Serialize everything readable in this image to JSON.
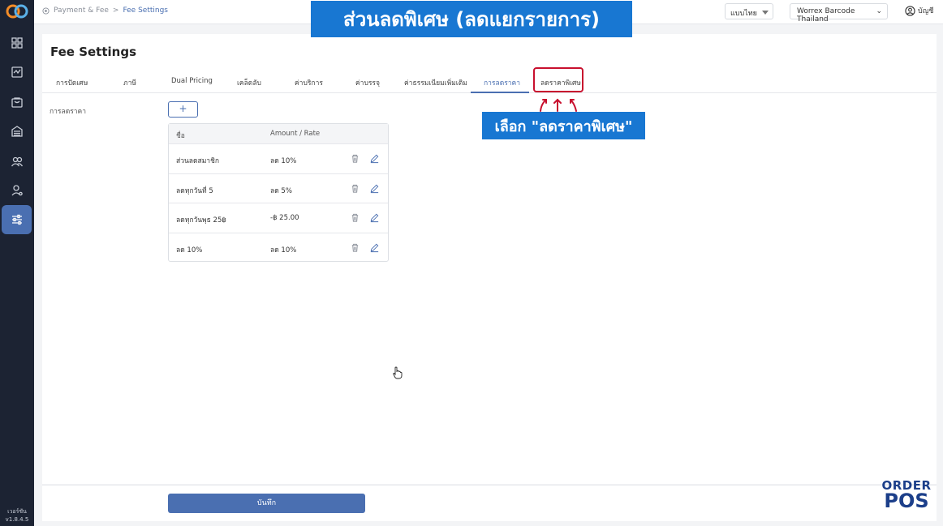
{
  "breadcrumb": {
    "parent": "Payment & Fee",
    "separator": ">",
    "current": "Fee Settings"
  },
  "header": {
    "language": "แบบไทย",
    "store": "Worrex Barcode Thailand",
    "account_label": "บัญชี"
  },
  "sidebar": {
    "items": [
      {
        "icon": "grid-icon"
      },
      {
        "icon": "sales-icon"
      },
      {
        "icon": "bag-icon"
      },
      {
        "icon": "inventory-icon"
      },
      {
        "icon": "customers-icon"
      },
      {
        "icon": "staff-icon"
      },
      {
        "icon": "settings-sliders-icon",
        "active": true
      }
    ],
    "version_label": "เวอร์ชัน",
    "version": "v1.8.4.5"
  },
  "page": {
    "title": "Fee Settings",
    "tabs": [
      {
        "label": "การปัดเศษ"
      },
      {
        "label": "ภาษี"
      },
      {
        "label": "Dual Pricing"
      },
      {
        "label": "เคล็ดลับ"
      },
      {
        "label": "ค่าบริการ"
      },
      {
        "label": "ค่าบรรจุ"
      },
      {
        "label": "ค่าธรรมเนียมเพิ่มเติม"
      },
      {
        "label": "การลดราคา",
        "active": true
      },
      {
        "label": "ลดราคาพิเศษ",
        "highlighted": true
      }
    ],
    "section_label": "การลดราคา",
    "add_button": "+",
    "table": {
      "headers": [
        "ชื่อ",
        "Amount / Rate"
      ],
      "rows": [
        {
          "name": "ส่วนลดสมาชิก",
          "amount": "ลด 10%"
        },
        {
          "name": "ลดทุกวันที่ 5",
          "amount": "ลด 5%"
        },
        {
          "name": "ลดทุกวันพุธ 25฿",
          "amount": "-฿ 25.00"
        },
        {
          "name": "ลด 10%",
          "amount": "ลด 10%"
        }
      ]
    },
    "save_button": "บันทึก"
  },
  "annotations": {
    "top_banner": "ส่วนลดพิเศษ (ลดแยกรายการ)",
    "select_banner": "เลือก \"ลดราคาพิเศษ\""
  },
  "brand": {
    "top": "ORDER",
    "bottom": "POS"
  },
  "colors": {
    "accent": "#4a6fb1",
    "sidebar": "#1c2333",
    "highlight": "#c8102e",
    "banner": "#1877d2"
  }
}
